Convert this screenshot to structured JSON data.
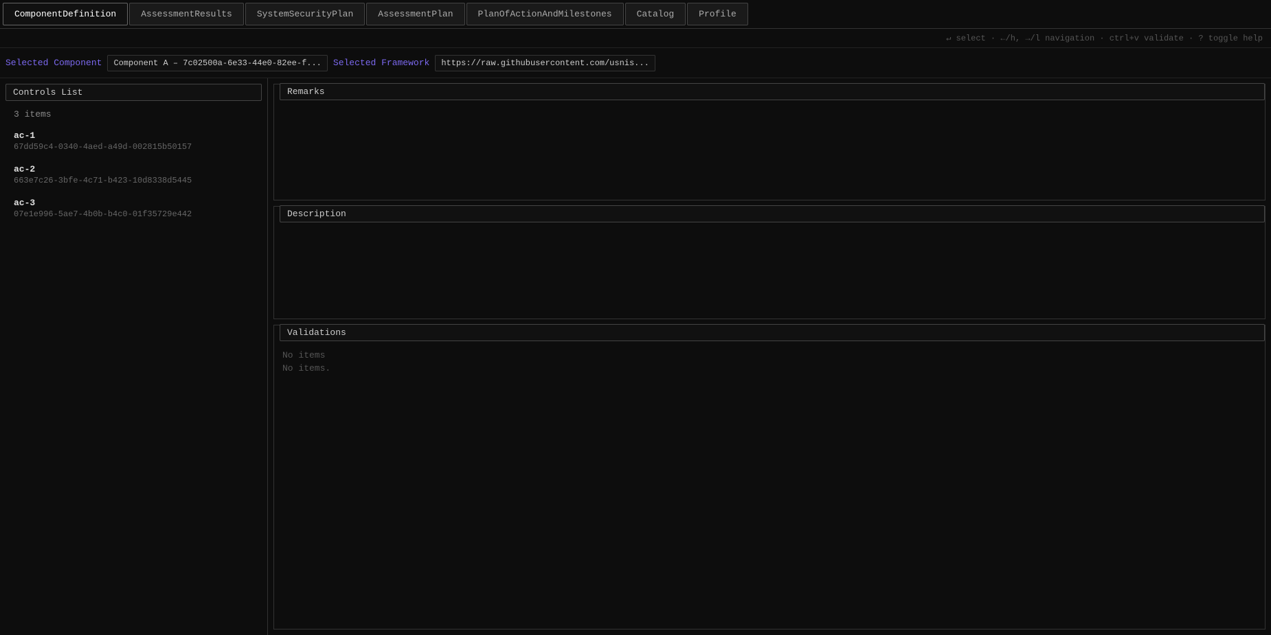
{
  "tabs": [
    {
      "label": "ComponentDefinition",
      "active": true
    },
    {
      "label": "AssessmentResults",
      "active": false
    },
    {
      "label": "SystemSecurityPlan",
      "active": false
    },
    {
      "label": "AssessmentPlan",
      "active": false
    },
    {
      "label": "PlanOfActionAndMilestones",
      "active": false
    },
    {
      "label": "Catalog",
      "active": false
    },
    {
      "label": "Profile",
      "active": false
    }
  ],
  "hint_bar": {
    "text": "↵ select · ←/h, →/l navigation · ctrl+v validate · ? toggle help"
  },
  "selection_bar": {
    "component_label": "Selected Component",
    "component_value": "Component A – 7c02500a-6e33-44e0-82ee-f...",
    "framework_label": "Selected Framework",
    "framework_value": "https://raw.githubusercontent.com/usnis..."
  },
  "controls_list": {
    "header": "Controls List",
    "item_count": "3 items",
    "items": [
      {
        "id": "ac-1",
        "uuid": "67dd59c4-0340-4aed-a49d-002815b50157"
      },
      {
        "id": "ac-2",
        "uuid": "663e7c26-3bfe-4c71-b423-10d8338d5445"
      },
      {
        "id": "ac-3",
        "uuid": "07e1e996-5ae7-4b0b-b4c0-01f35729e442"
      }
    ]
  },
  "remarks": {
    "header": "Remarks",
    "content": ""
  },
  "description": {
    "header": "Description",
    "content": ""
  },
  "validations": {
    "header": "Validations",
    "no_items_1": "No items",
    "no_items_2": "No items."
  }
}
